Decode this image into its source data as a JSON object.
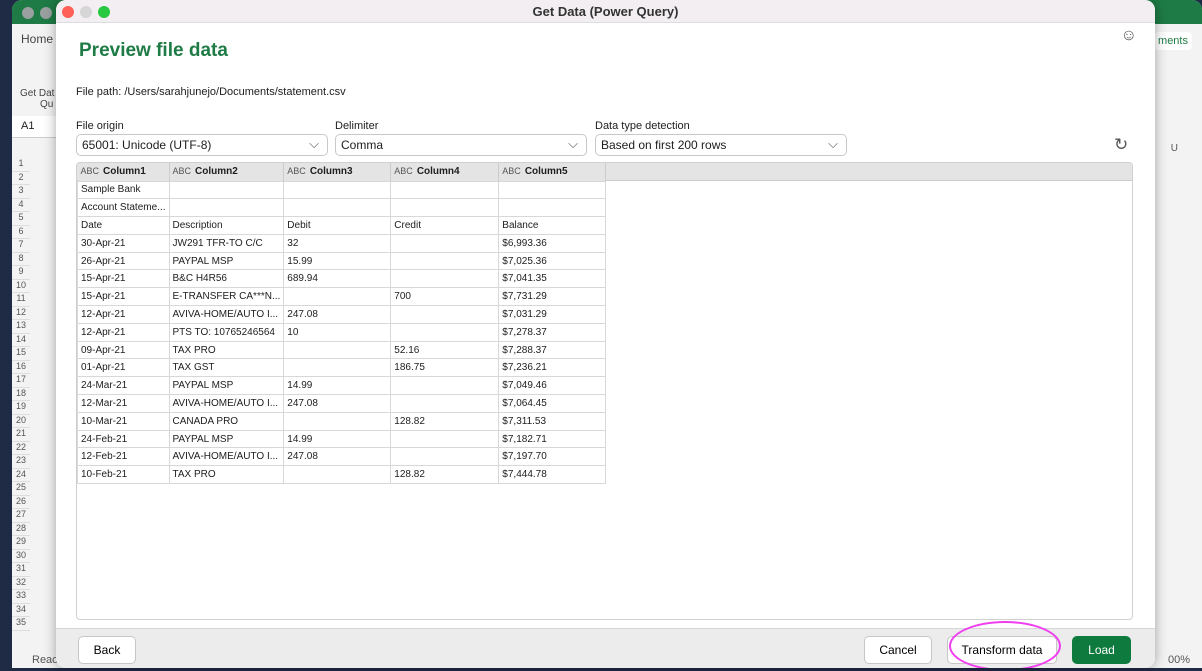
{
  "background_app": {
    "tab": "Home",
    "get_data_label": "Get Dat",
    "get_data_label2": "Qu",
    "name_box": "A1",
    "comments": "ments",
    "column_u": "U",
    "status": "Reac",
    "zoom": "00%",
    "row_numbers": [
      "1",
      "2",
      "3",
      "4",
      "5",
      "6",
      "7",
      "8",
      "9",
      "10",
      "11",
      "12",
      "13",
      "14",
      "15",
      "16",
      "17",
      "18",
      "19",
      "20",
      "21",
      "22",
      "23",
      "24",
      "25",
      "26",
      "27",
      "28",
      "29",
      "30",
      "31",
      "32",
      "33",
      "34",
      "35"
    ]
  },
  "window": {
    "title": "Get Data (Power Query)",
    "feedback_icon": "smiley-icon"
  },
  "page_title": "Preview file data",
  "file_path": {
    "label": "File path:",
    "value": "/Users/sarahjunejo/Documents/statement.csv"
  },
  "fields": {
    "file_origin": {
      "label": "File origin",
      "value": "65001: Unicode (UTF-8)"
    },
    "delimiter": {
      "label": "Delimiter",
      "value": "Comma"
    },
    "type_detection": {
      "label": "Data type detection",
      "value": "Based on first 200 rows"
    }
  },
  "table": {
    "type_icon": "ABC",
    "columns": [
      "Column1",
      "Column2",
      "Column3",
      "Column4",
      "Column5"
    ],
    "rows": [
      [
        "Sample Bank",
        "",
        "",
        "",
        ""
      ],
      [
        "Account Stateme...",
        "",
        "",
        "",
        ""
      ],
      [
        "Date",
        "Description",
        "Debit",
        "Credit",
        "Balance"
      ],
      [
        "30-Apr-21",
        "JW291 TFR-TO C/C",
        "32",
        "",
        "$6,993.36"
      ],
      [
        "26-Apr-21",
        "PAYPAL MSP",
        "15.99",
        "",
        "$7,025.36"
      ],
      [
        "15-Apr-21",
        "B&C H4R56",
        "689.94",
        "",
        "$7,041.35"
      ],
      [
        "15-Apr-21",
        "E-TRANSFER CA***N...",
        "",
        "700",
        "$7,731.29"
      ],
      [
        "12-Apr-21",
        "AVIVA-HOME/AUTO I...",
        "247.08",
        "",
        "$7,031.29"
      ],
      [
        "12-Apr-21",
        "PTS TO: 10765246564",
        "10",
        "",
        "$7,278.37"
      ],
      [
        "09-Apr-21",
        "TAX PRO",
        "",
        "52.16",
        "$7,288.37"
      ],
      [
        "01-Apr-21",
        "TAX GST",
        "",
        "186.75",
        "$7,236.21"
      ],
      [
        "24-Mar-21",
        "PAYPAL MSP",
        "14.99",
        "",
        "$7,049.46"
      ],
      [
        "12-Mar-21",
        "AVIVA-HOME/AUTO I...",
        "247.08",
        "",
        "$7,064.45"
      ],
      [
        "10-Mar-21",
        "CANADA PRO",
        "",
        "128.82",
        "$7,311.53"
      ],
      [
        "24-Feb-21",
        "PAYPAL MSP",
        "14.99",
        "",
        "$7,182.71"
      ],
      [
        "12-Feb-21",
        "AVIVA-HOME/AUTO I...",
        "247.08",
        "",
        "$7,197.70"
      ],
      [
        "10-Feb-21",
        "TAX PRO",
        "",
        "128.82",
        "$7,444.78"
      ]
    ]
  },
  "buttons": {
    "back": "Back",
    "cancel": "Cancel",
    "transform": "Transform data",
    "load": "Load"
  },
  "colors": {
    "accent": "#1e7b45",
    "load_button": "#0e7a3e",
    "highlight_ring": "#f03df0"
  }
}
